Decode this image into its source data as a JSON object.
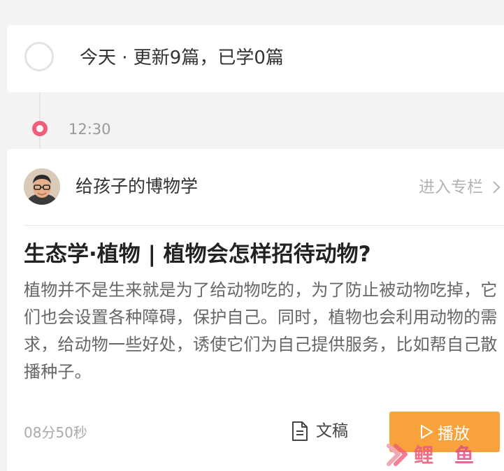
{
  "summary": {
    "text": "今天 · 更新9篇，已学0篇"
  },
  "timeline": {
    "time": "12:30"
  },
  "article": {
    "column_name": "给孩子的博物学",
    "enter_column_label": "进入专栏",
    "title": "生态学·植物 | 植物会怎样招待动物?",
    "description": "植物并不是生来就是为了给动物吃的，为了防止被动物吃掉，它们也会设置各种障碍，保护自己。同时，植物也会利用动物的需求，给动物一些好处，诱使它们为自己提供服务，比如帮自己散播种子。",
    "duration": "08分50秒",
    "transcript_label": "文稿",
    "play_label": "播放"
  },
  "watermark": {
    "text": "鲤鱼"
  },
  "colors": {
    "accent_orange": "#f8a23c",
    "timeline_pink": "#ef5f79",
    "background": "#f3f3f4"
  }
}
